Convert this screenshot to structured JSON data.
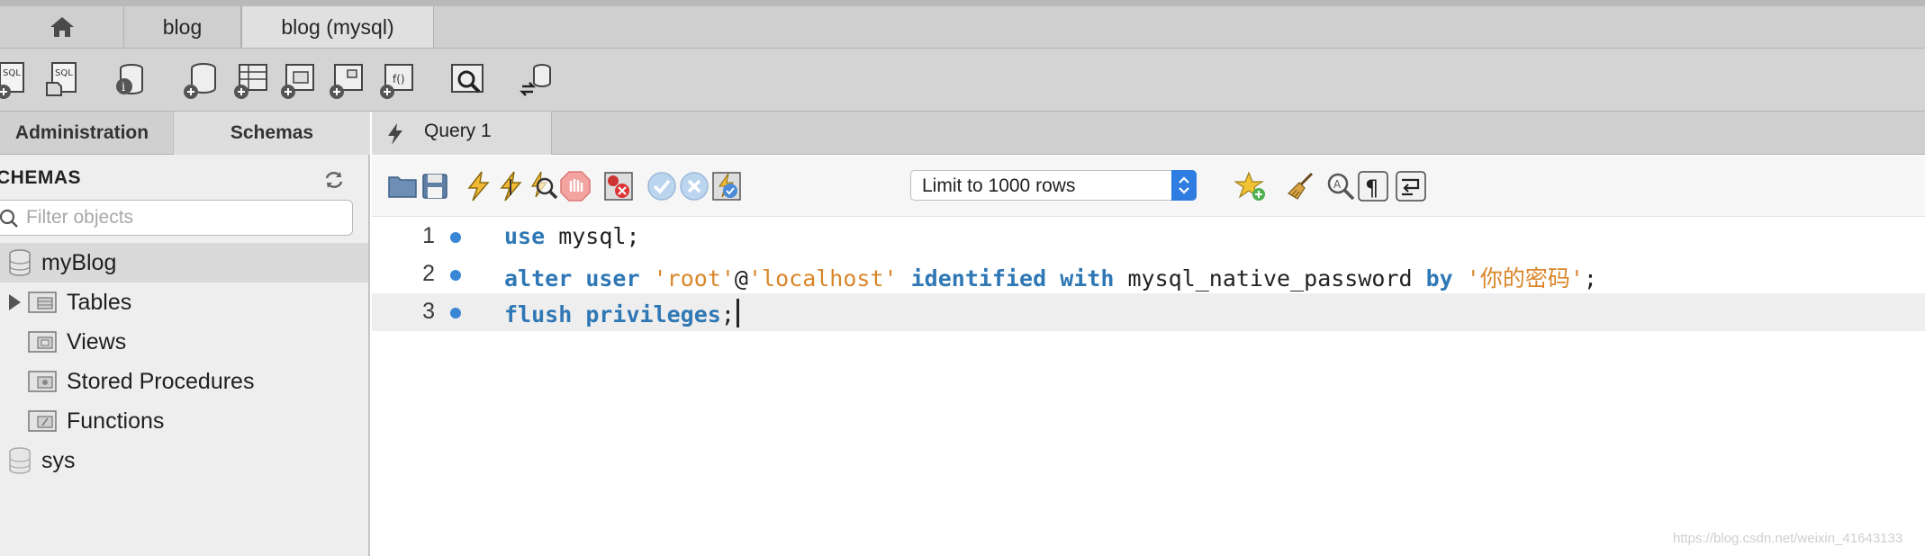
{
  "connection_tabs": [
    {
      "label": "",
      "icon": "home-icon"
    },
    {
      "label": "blog"
    },
    {
      "label": "blog (mysql)",
      "active": true
    }
  ],
  "main_toolbar": {
    "icons": [
      "new-sql-tab-icon",
      "open-sql-file-icon",
      "server-info-icon",
      "create-schema-icon",
      "create-table-icon",
      "create-view-icon",
      "create-procedure-icon",
      "create-function-icon",
      "search-table-data-icon",
      "reconnect-icon"
    ]
  },
  "sidebar": {
    "tabs": {
      "administration": "Administration",
      "schemas": "Schemas"
    },
    "section_title": "CHEMAS",
    "filter_placeholder": "Filter objects",
    "tree": {
      "schema_1": "myBlog",
      "tables": "Tables",
      "views": "Views",
      "stored_procedures": "Stored Procedures",
      "functions": "Functions",
      "schema_2": "sys"
    }
  },
  "query": {
    "tab_label": "Query 1",
    "limit_select": {
      "value": "Limit to 1000 rows"
    },
    "editor_icons": [
      "open-file-icon",
      "save-icon",
      "execute-icon",
      "execute-current-icon",
      "explain-icon",
      "stop-icon",
      "toggle-error-icon",
      "commit-icon",
      "rollback-icon",
      "autocommit-icon",
      "add-snippet-icon",
      "beautify-icon",
      "find-icon",
      "invisible-chars-icon",
      "wrap-icon"
    ],
    "lines": [
      {
        "num": "1",
        "kw1": "use",
        "rest": " mysql;"
      },
      {
        "num": "2",
        "kw1": "alter",
        "t1": " ",
        "kw2": "user",
        "t2": " ",
        "s1": "'root'",
        "t3": "@",
        "s2": "'localhost'",
        "t4": " ",
        "kw3": "identified",
        "t5": " ",
        "kw4": "with",
        "t6": " mysql_native_password ",
        "kw5": "by",
        "t7": " ",
        "s3": "'你的密码'",
        "t8": ";"
      },
      {
        "num": "3",
        "kw1": "flush",
        "t1": " ",
        "kw2": "privileges",
        "t2": ";"
      }
    ]
  },
  "watermark": "https://blog.csdn.net/weixin_41643133",
  "colors": {
    "keyword": "#2f78b5",
    "string": "#d9862a",
    "accent": "#2f7de1"
  }
}
